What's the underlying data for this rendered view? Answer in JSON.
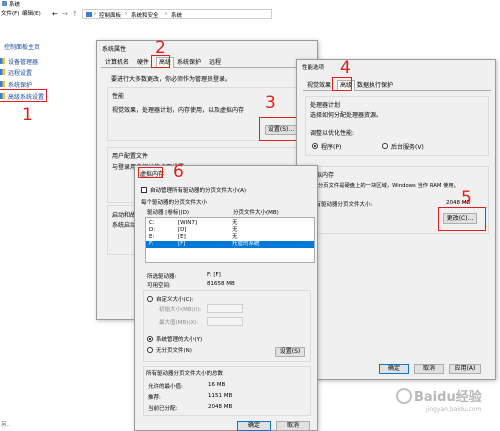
{
  "explorer": {
    "title": "系统",
    "menu": [
      "文件(F)",
      "编辑(E)"
    ],
    "breadcrumb": [
      "控制面板",
      "系统和安全",
      "系统"
    ],
    "sidebar_home": "控制面板主页",
    "sidebar_items": [
      "设备管理器",
      "远程设置",
      "系统保护",
      "高级系统设置"
    ]
  },
  "sysprops": {
    "title": "系统属性",
    "tabs": [
      "计算机名",
      "硬件",
      "高级",
      "系统保护",
      "远程"
    ],
    "intro": "要进行大多数更改，你必须作为管理员登录。",
    "perf_title": "性能",
    "perf_desc": "视觉效果，处理器计划，内存使用，以及虚拟内存",
    "settings_btn": "设置(S)...",
    "profile_title": "用户配置文件",
    "profile_desc": "与登录用户相关的桌面设置",
    "startup_title": "启动和故障恢复",
    "startup_desc": "系统启动、系统故障和调试信息"
  },
  "perfopts": {
    "title": "性能选项",
    "tabs": [
      "视觉效果",
      "高级",
      "数据执行保护"
    ],
    "sched_title": "处理器计划",
    "sched_desc": "选择如何分配处理器资源。",
    "adjust_label": "调整以优化性能:",
    "opt_programs": "程序(P)",
    "opt_background": "后台服务(V)",
    "vm_title": "虚拟内存",
    "vm_desc": "分页文件是硬盘上的一块区域，Windows 当作 RAM 使用。",
    "vm_total_label": "所有驱动器分页文件大小:",
    "vm_total_value": "2048 MB",
    "change_btn": "更改(C)...",
    "ok": "确定",
    "cancel": "取消",
    "apply": "应用(A)"
  },
  "vmdialog": {
    "title": "虚拟内存",
    "auto_manage": "自动管理所有驱动器的分页文件大小(A)",
    "per_drive_title": "每个驱动器的分页文件大小",
    "col_drive": "驱动器 [卷标](D)",
    "col_size": "分页文件大小(MB)",
    "drives": [
      {
        "drive": "C:",
        "label": "[WIN7]",
        "size": "无",
        "selected": false
      },
      {
        "drive": "D:",
        "label": "[D]",
        "size": "无",
        "selected": false
      },
      {
        "drive": "E:",
        "label": "[E]",
        "size": "无",
        "selected": false
      },
      {
        "drive": "F:",
        "label": "[F]",
        "size": "托管的系统",
        "selected": true
      }
    ],
    "sel_drive_label": "所选驱动器:",
    "sel_drive_value": "F:  [F]",
    "free_label": "可用空间:",
    "free_value": "81658 MB",
    "custom_label": "自定义大小(C):",
    "initial_label": "初始大小(MB)(I):",
    "max_label": "最大值(MB)(X):",
    "system_managed": "系统管理的大小(Y)",
    "no_paging": "无分页文件(N)",
    "set_btn": "设置(S)",
    "total_title": "所有驱动器分页文件大小的总数",
    "min_label": "允许的最小值:",
    "min_value": "16 MB",
    "rec_label": "推荐:",
    "rec_value": "1151 MB",
    "cur_label": "当前已分配:",
    "cur_value": "2048 MB",
    "ok": "确定",
    "cancel": "取消"
  },
  "annotations": [
    "1",
    "2",
    "3",
    "4",
    "5",
    "6"
  ],
  "watermark": "Baidu经验",
  "watermark_url": "jingyan.baidu.com",
  "colors": {
    "annotation_red": "#e02020",
    "selection_blue": "#0078d7"
  }
}
